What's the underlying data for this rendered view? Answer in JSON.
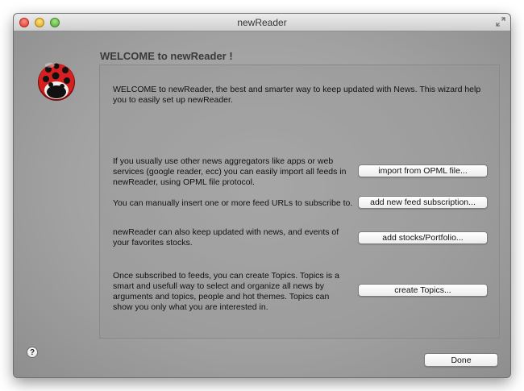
{
  "window": {
    "title": "newReader"
  },
  "welcome": {
    "heading": "WELCOME to newReader !",
    "intro": "WELCOME to newReader, the best and smarter way to keep updated with News. This wizard help you to easily set up newReader."
  },
  "options": [
    {
      "description": "If you usually use other news aggregators like apps or web services (google reader, ecc) you can easily import all feeds in newReader, using OPML file protocol.",
      "button_label": "import from OPML file..."
    },
    {
      "description": "You can manually insert one or more feed URLs to subscribe to.",
      "button_label": "add new feed subscription..."
    },
    {
      "description": "newReader can also keep updated with news, and events of your favorites stocks.",
      "button_label": "add stocks/Portfolio..."
    },
    {
      "description": "Once subscribed to feeds, you can create Topics. Topics is a smart and usefull way to select and organize all news by arguments and topics, people and hot themes. Topics can show you only what you are interested in.",
      "button_label": "create Topics..."
    }
  ],
  "footer": {
    "help_label": "?",
    "done_label": "Done"
  },
  "icons": {
    "logo": "ladybug-icon",
    "fullscreen": "fullscreen-arrows-icon"
  },
  "colors": {
    "ladybug_red": "#d61f1f",
    "window_bg": "#a2a2a2"
  }
}
